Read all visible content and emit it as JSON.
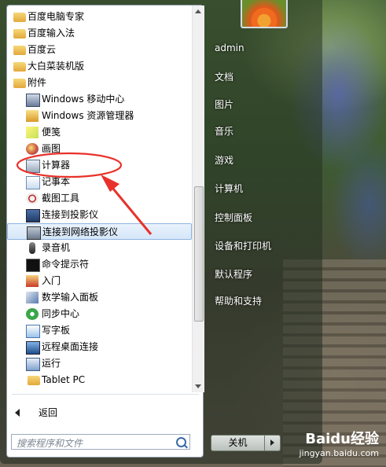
{
  "programs": [
    {
      "label": "百度电脑专家",
      "type": "folder"
    },
    {
      "label": "百度输入法",
      "type": "folder"
    },
    {
      "label": "百度云",
      "type": "folder"
    },
    {
      "label": "大白菜装机版",
      "type": "folder"
    },
    {
      "label": "附件",
      "type": "folder"
    },
    {
      "label": "Windows 移动中心",
      "type": "app",
      "icon": "mobility-center-icon"
    },
    {
      "label": "Windows 资源管理器",
      "type": "app",
      "icon": "explorer-icon"
    },
    {
      "label": "便笺",
      "type": "app",
      "icon": "sticky-notes-icon"
    },
    {
      "label": "画图",
      "type": "app",
      "icon": "paint-icon"
    },
    {
      "label": "计算器",
      "type": "app",
      "icon": "calculator-icon"
    },
    {
      "label": "记事本",
      "type": "app",
      "icon": "notepad-icon"
    },
    {
      "label": "截图工具",
      "type": "app",
      "icon": "snipping-tool-icon"
    },
    {
      "label": "连接到投影仪",
      "type": "app",
      "icon": "projector-icon"
    },
    {
      "label": "连接到网络投影仪",
      "type": "app",
      "icon": "network-projector-icon"
    },
    {
      "label": "录音机",
      "type": "app",
      "icon": "sound-recorder-icon"
    },
    {
      "label": "命令提示符",
      "type": "app",
      "icon": "cmd-icon"
    },
    {
      "label": "入门",
      "type": "app",
      "icon": "getting-started-icon"
    },
    {
      "label": "数学输入面板",
      "type": "app",
      "icon": "math-input-icon"
    },
    {
      "label": "同步中心",
      "type": "app",
      "icon": "sync-center-icon"
    },
    {
      "label": "写字板",
      "type": "app",
      "icon": "wordpad-icon"
    },
    {
      "label": "远程桌面连接",
      "type": "app",
      "icon": "remote-desktop-icon"
    },
    {
      "label": "运行",
      "type": "app",
      "icon": "run-icon"
    },
    {
      "label": "Tablet PC",
      "type": "folder-sub"
    }
  ],
  "back_label": "返回",
  "search_placeholder": "搜索程序和文件",
  "right_items": [
    "admin",
    "文档",
    "图片",
    "音乐",
    "游戏",
    "计算机",
    "控制面板",
    "设备和打印机",
    "默认程序",
    "帮助和支持"
  ],
  "shutdown_label": "关机",
  "watermark": {
    "logo": "Baidu经验",
    "url": "jingyan.baidu.com"
  },
  "colors": {
    "annotation": "#e8312a",
    "selection_border": "#8fb4e0"
  }
}
